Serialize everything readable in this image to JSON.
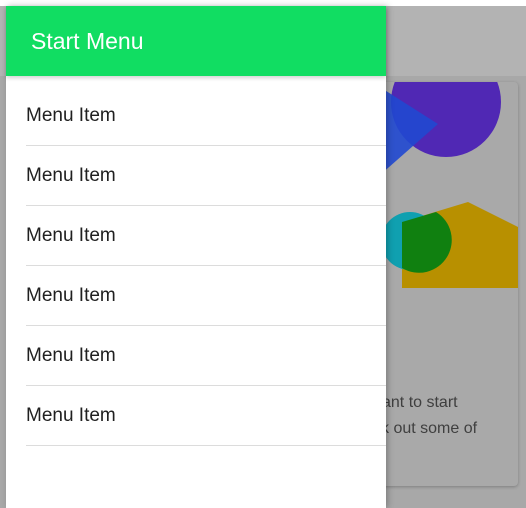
{
  "drawer": {
    "title": "Start Menu",
    "items": [
      {
        "label": "Menu Item"
      },
      {
        "label": "Menu Item"
      },
      {
        "label": "Menu Item"
      },
      {
        "label": "Menu Item"
      },
      {
        "label": "Menu Item"
      },
      {
        "label": "Menu Item"
      }
    ]
  },
  "background_card": {
    "text_line_1": "ant to start",
    "text_line_2": "k out some of"
  },
  "colors": {
    "header_green": "#11dd62",
    "scrim": "#a8a8a8",
    "illustration_purple": "#5028b4",
    "illustration_blue": "#2048d0",
    "illustration_teal": "#10a0b0",
    "illustration_green": "#108010",
    "illustration_gold": "#b89000"
  }
}
